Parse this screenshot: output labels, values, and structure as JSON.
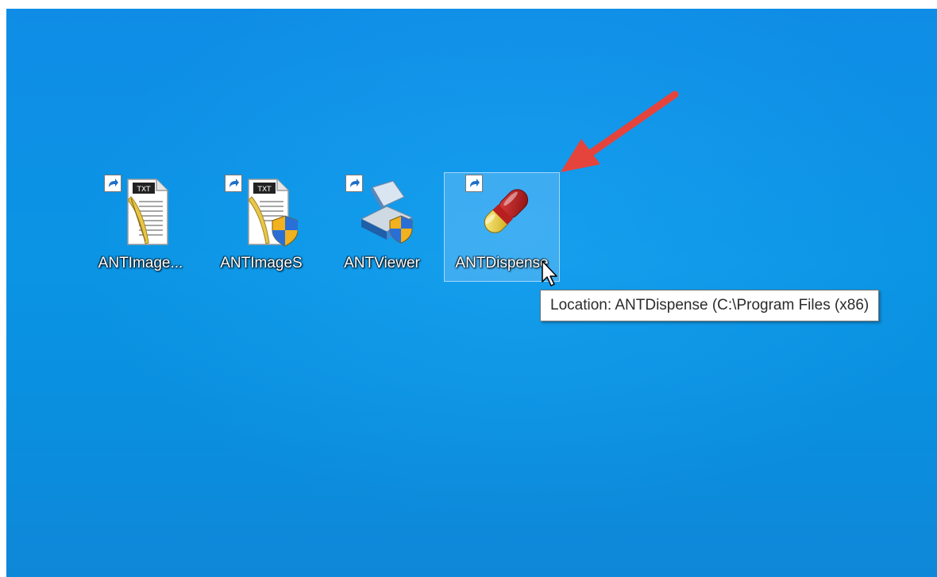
{
  "desktop": {
    "background_color": "#0b94e4",
    "icons": [
      {
        "label": "ANTImage...",
        "icon": "text-document-quill-icon",
        "shortcut": true,
        "selected": false
      },
      {
        "label": "ANTImageS",
        "icon": "text-document-quill-shield-icon",
        "shortcut": true,
        "selected": false
      },
      {
        "label": "ANTViewer",
        "icon": "scanner-shield-icon",
        "shortcut": true,
        "selected": false
      },
      {
        "label": "ANTDispense",
        "icon": "pill-capsule-icon",
        "shortcut": true,
        "selected": true
      }
    ]
  },
  "tooltip": {
    "text": "Location: ANTDispense (C:\\Program Files (x86)"
  },
  "annotation": {
    "icon": "red-arrow-icon",
    "color": "#e5443c"
  },
  "cursor": {
    "icon": "mouse-pointer-icon"
  }
}
